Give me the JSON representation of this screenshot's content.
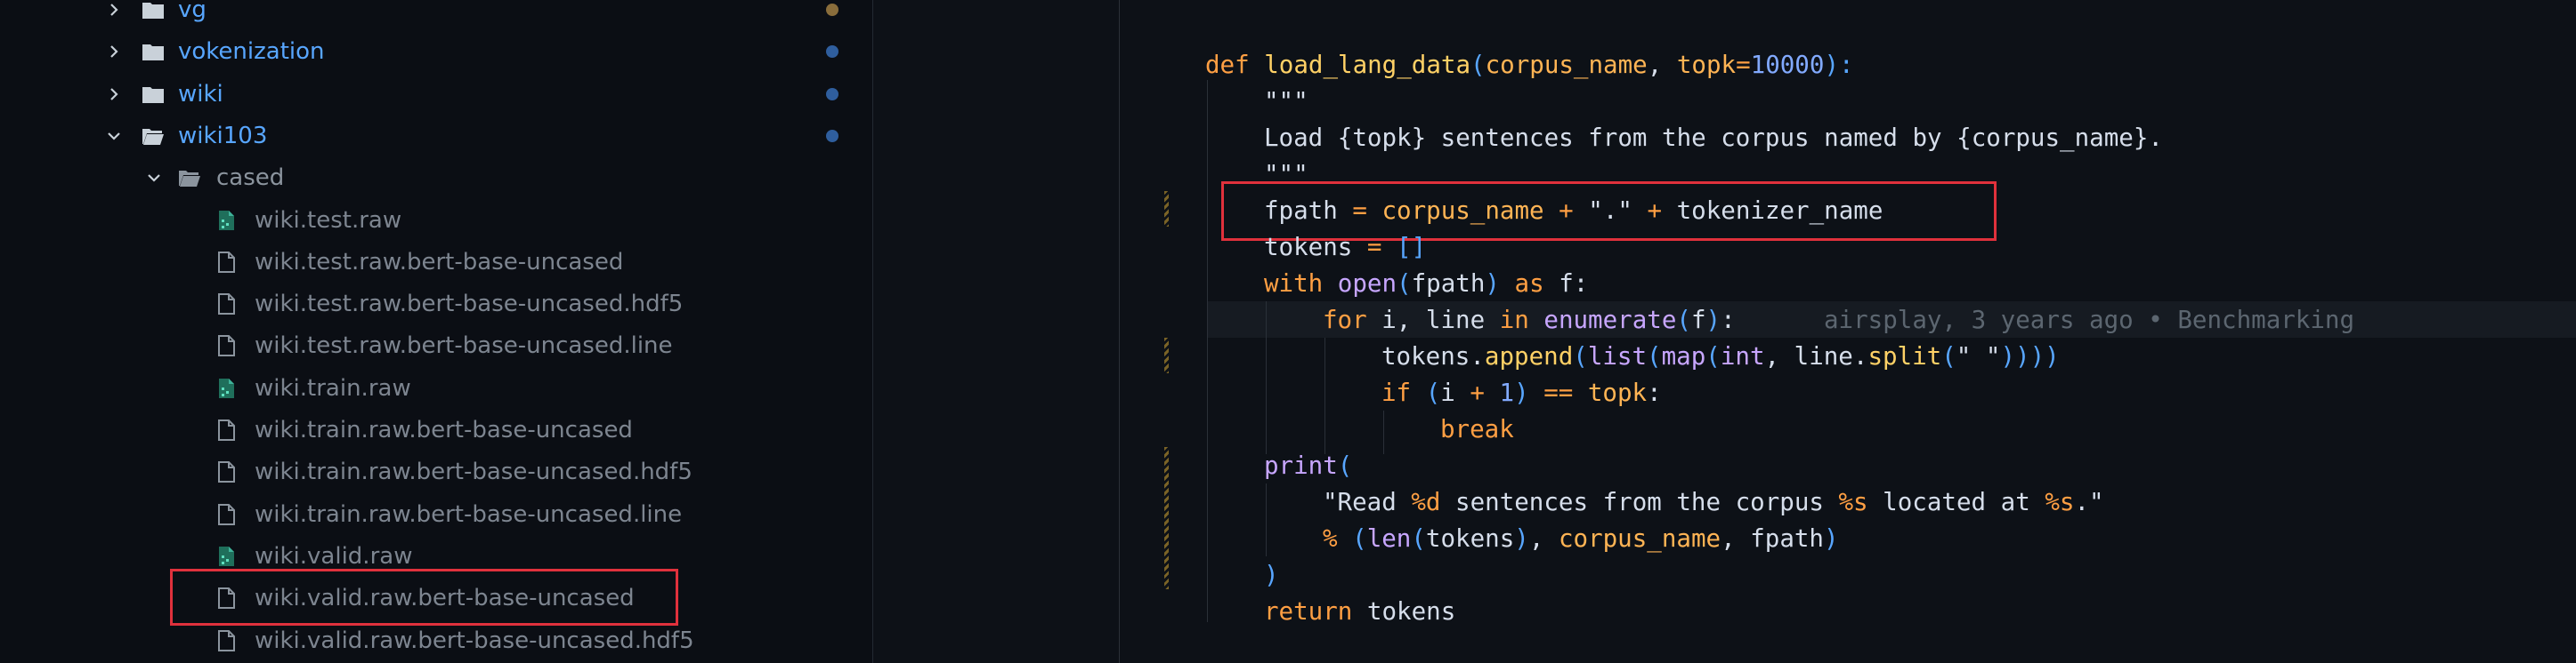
{
  "sidebar": {
    "items": [
      {
        "label": "vg",
        "type": "folder",
        "expanded": false,
        "level": 1,
        "dot": "#8a6d3b"
      },
      {
        "label": "vokenization",
        "type": "folder",
        "expanded": false,
        "level": 1,
        "dot": "#2f5e9e"
      },
      {
        "label": "wiki",
        "type": "folder",
        "expanded": false,
        "level": 1,
        "dot": "#2f5e9e"
      },
      {
        "label": "wiki103",
        "type": "folder",
        "expanded": true,
        "level": 1,
        "dot": "#2f5e9e"
      },
      {
        "label": "cased",
        "type": "folder",
        "expanded": true,
        "level": 2
      },
      {
        "label": "wiki.test.raw",
        "type": "raw-file",
        "level": 3
      },
      {
        "label": "wiki.test.raw.bert-base-uncased",
        "type": "file",
        "level": 3
      },
      {
        "label": "wiki.test.raw.bert-base-uncased.hdf5",
        "type": "file",
        "level": 3
      },
      {
        "label": "wiki.test.raw.bert-base-uncased.line",
        "type": "file",
        "level": 3
      },
      {
        "label": "wiki.train.raw",
        "type": "raw-file",
        "level": 3
      },
      {
        "label": "wiki.train.raw.bert-base-uncased",
        "type": "file",
        "level": 3
      },
      {
        "label": "wiki.train.raw.bert-base-uncased.hdf5",
        "type": "file",
        "level": 3
      },
      {
        "label": "wiki.train.raw.bert-base-uncased.line",
        "type": "file",
        "level": 3
      },
      {
        "label": "wiki.valid.raw",
        "type": "raw-file",
        "level": 3
      },
      {
        "label": "wiki.valid.raw.bert-base-uncased",
        "type": "file",
        "level": 3,
        "highlighted": true
      },
      {
        "label": "wiki.valid.raw.bert-base-uncased.hdf5",
        "type": "file",
        "level": 3
      }
    ]
  },
  "editor": {
    "blame": "airsplay, 3 years ago • Benchmarking",
    "code": {
      "l1_def": "def",
      "l1_name": "load_lang_data",
      "l1_p1": "corpus_name",
      "l1_p2": "topk",
      "l1_eq": "=",
      "l1_num": "10000",
      "l2": "\"\"\"",
      "l3": "Load {topk} sentences from the corpus named by {corpus_name}.",
      "l4": "\"\"\"",
      "l5_var": "fpath",
      "l5_op": " = ",
      "l5_a": "corpus_name",
      "l5_plus1": " + ",
      "l5_str": "\".\"",
      "l5_plus2": " + ",
      "l5_b": "tokenizer_name",
      "l6_var": "tokens",
      "l6_op": " = ",
      "l6_br": "[]",
      "l7_with": "with",
      "l7_open": "open",
      "l7_arg": "fpath",
      "l7_as": "as",
      "l7_f": "f:",
      "l8_for": "for",
      "l8_vars": "i, line",
      "l8_in": "in",
      "l8_enum": "enumerate",
      "l8_arg": "f",
      "l9_obj": "tokens",
      "l9_app": "append",
      "l9_list": "list",
      "l9_map": "map",
      "l9_int": "int",
      "l9_line": "line",
      "l9_split": "split",
      "l9_str": "\" \"",
      "l10_if": "if",
      "l10_i": "i",
      "l10_plus": "+",
      "l10_one": "1",
      "l10_eq": "==",
      "l10_topk": "topk",
      "l11": "break",
      "l12": "print",
      "l13_s1": "\"Read ",
      "l13_f1": "%d",
      "l13_s2": " sentences from the corpus ",
      "l13_f2": "%s",
      "l13_s3": " located at ",
      "l13_f3": "%s",
      "l13_s4": ".\"",
      "l14_pct": "%",
      "l14_len": "len",
      "l14_tok": "tokens",
      "l14_cn": "corpus_name",
      "l14_fp": "fpath",
      "l15": ")",
      "l16_ret": "return",
      "l16_tok": "tokens"
    }
  },
  "colors": {
    "highlight_box": "#e0313c",
    "folder": "#58a6ff",
    "keyword": "#ff9f43"
  }
}
